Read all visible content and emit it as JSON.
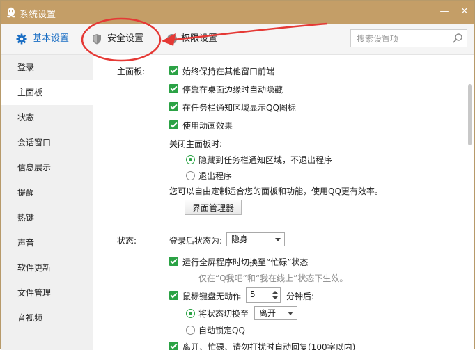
{
  "window": {
    "title": "系统设置",
    "theme_color": "#c49e67"
  },
  "titlebar": {
    "minimize": "—",
    "close": "✕"
  },
  "tabs": [
    {
      "label": "基本设置",
      "icon": "gear-icon",
      "color": "#1a6ec4"
    },
    {
      "label": "安全设置",
      "icon": "shield-icon"
    },
    {
      "label": "权限设置",
      "icon": "question-icon"
    }
  ],
  "search": {
    "placeholder": "搜索设置项",
    "value": ""
  },
  "sidebar": {
    "items": [
      {
        "label": "登录"
      },
      {
        "label": "主面板",
        "active": true
      },
      {
        "label": "状态"
      },
      {
        "label": "会话窗口"
      },
      {
        "label": "信息展示"
      },
      {
        "label": "提醒"
      },
      {
        "label": "热键"
      },
      {
        "label": "声音"
      },
      {
        "label": "软件更新"
      },
      {
        "label": "文件管理"
      },
      {
        "label": "音视频"
      }
    ]
  },
  "main_panel": {
    "section_label": "主面板:",
    "options": [
      {
        "label": "始终保持在其他窗口前端",
        "checked": true
      },
      {
        "label": "停靠在桌面边缘时自动隐藏",
        "checked": true
      },
      {
        "label": "在任务栏通知区域显示QQ图标",
        "checked": true
      },
      {
        "label": "使用动画效果",
        "checked": true
      }
    ],
    "close_label": "关闭主面板时:",
    "close_options": [
      {
        "label": "隐藏到任务栏通知区域，不退出程序",
        "selected": true
      },
      {
        "label": "退出程序",
        "selected": false
      }
    ],
    "customize_text": "您可以自由定制适合您的面板和功能，使用QQ更有效率。",
    "manager_button": "界面管理器"
  },
  "status_panel": {
    "section_label": "状态:",
    "after_login_label": "登录后状态为:",
    "after_login_value": "隐身",
    "fullscreen_option": "运行全屏程序时切换至“忙碌”状态",
    "fullscreen_checked": true,
    "fullscreen_note": "仅在“Q我吧”和“我在线上”状态下生效。",
    "idle_label": "鼠标键盘无动作",
    "idle_checked": true,
    "idle_minutes": "5",
    "idle_suffix": "分钟后:",
    "switch_label": "将状态切换至",
    "switch_value": "离开",
    "switch_selected": true,
    "autolock_label": "自动锁定QQ",
    "autolock_selected": false,
    "autoreply_label": "离开、忙碌、请勿打扰时自动回复(100字以内)",
    "autoreply_checked": true
  },
  "annotation": {
    "color": "#e53935"
  }
}
